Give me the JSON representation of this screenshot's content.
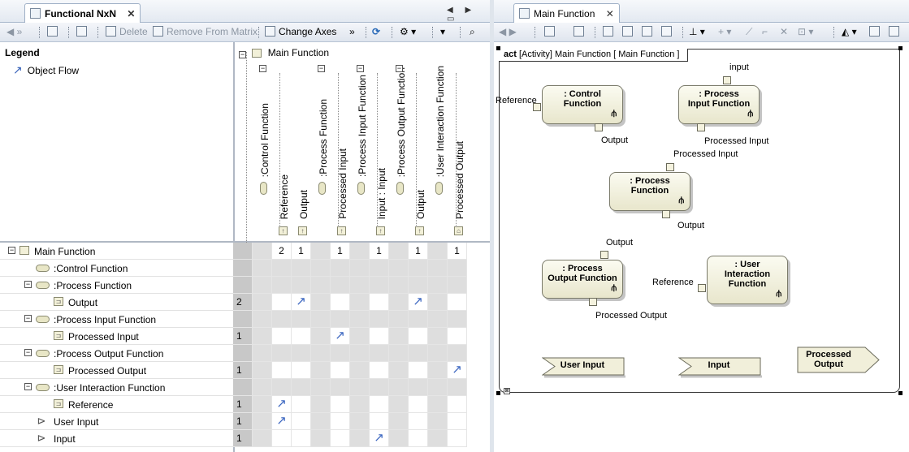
{
  "left_panel": {
    "tab": {
      "title": "Functional NxN",
      "close": "✕"
    },
    "nav": "◀ ▶ ▭",
    "toolbar": {
      "delete": "Delete",
      "remove_from_matrix": "Remove From Matrix",
      "change_axes": "Change Axes"
    },
    "legend": {
      "title": "Legend",
      "item": "Object Flow"
    },
    "column_root": "Main Function",
    "columns": [
      "Reference",
      "Output",
      "Processed Input",
      "Input : Input",
      "Output",
      "Processed Output"
    ],
    "column_groups": [
      ":Control Function",
      ":Process Function",
      ":Process Input Function",
      ":Process Output Function",
      ":User Interaction Function"
    ],
    "column_totals": [
      "",
      "2",
      "1",
      "",
      "1",
      "",
      "1",
      "",
      "1",
      "",
      "1"
    ],
    "rows": [
      {
        "label": "Main Function",
        "total": ""
      },
      {
        "label": ":Control Function",
        "total": ""
      },
      {
        "label": ":Process Function",
        "total": ""
      },
      {
        "label": "Output",
        "total": "2"
      },
      {
        "label": ":Process Input Function",
        "total": ""
      },
      {
        "label": "Processed Input",
        "total": "1"
      },
      {
        "label": ":Process Output Function",
        "total": ""
      },
      {
        "label": "Processed Output",
        "total": "1"
      },
      {
        "label": ":User Interaction Function",
        "total": ""
      },
      {
        "label": "Reference",
        "total": "1"
      },
      {
        "label": "User Input",
        "total": "1"
      },
      {
        "label": "Input",
        "total": "1"
      }
    ],
    "arrow_glyph": "↗"
  },
  "right_panel": {
    "tab": {
      "title": "Main Function",
      "close": "✕"
    },
    "frame_label": "act [Activity] Main Function [ Main Function ]",
    "actions": [
      {
        "name": ": Control\nFunction"
      },
      {
        "name": ": Process\nInput Function"
      },
      {
        "name": ": Process\nFunction"
      },
      {
        "name": ": Process\nOutput Function"
      },
      {
        "name": ": User\nInteraction\nFunction"
      }
    ],
    "pins": {
      "control_reference": "Reference",
      "control_output": "Output",
      "pif_input": "input",
      "pif_output": "Processed Input",
      "pf_input": "Processed Input",
      "pf_output": "Output",
      "pof_input": "Output",
      "pof_output": "Processed Output",
      "uif_reference": "Reference"
    },
    "signals": {
      "user_input": "User Input",
      "input": "Input",
      "processed_output": "Processed\nOutput"
    }
  }
}
